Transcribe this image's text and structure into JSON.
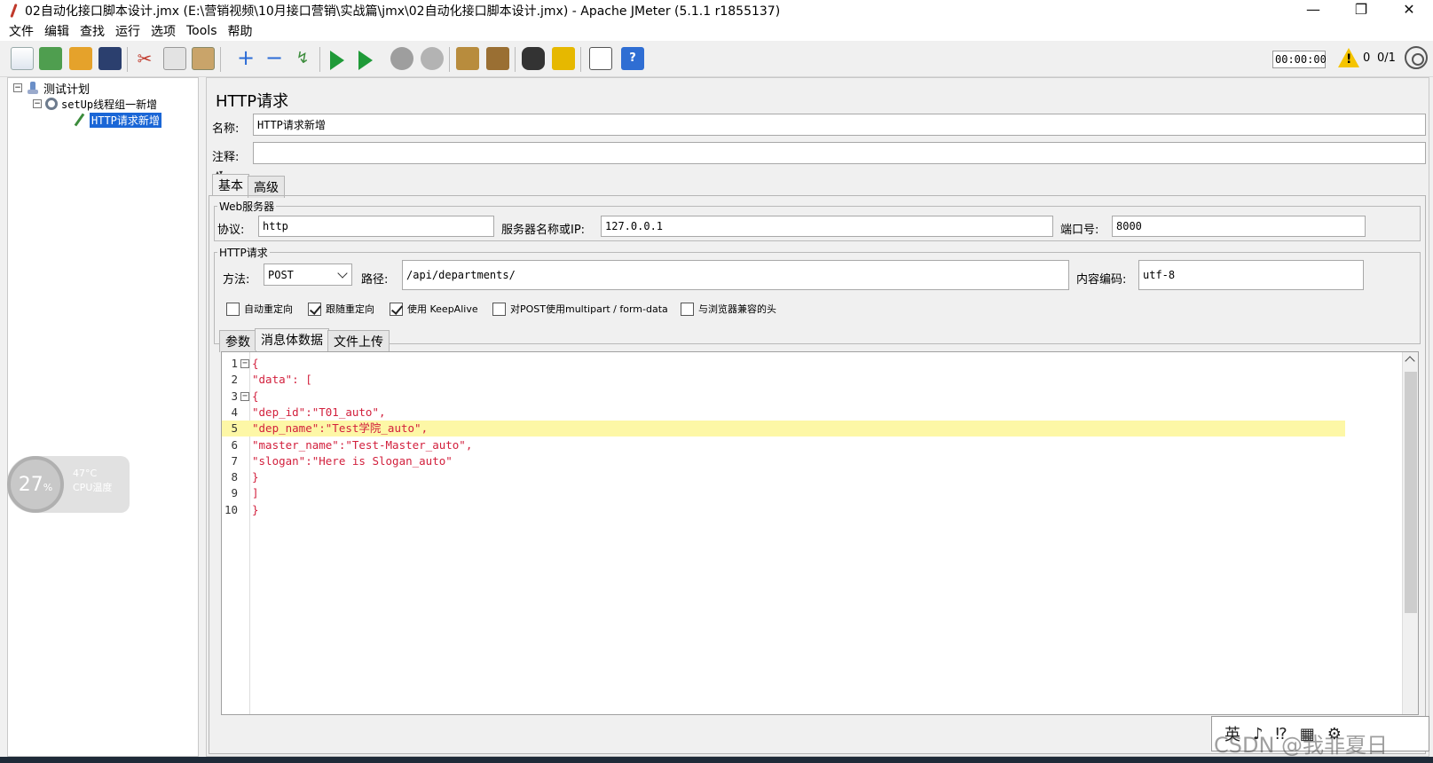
{
  "window": {
    "title": "02自动化接口脚本设计.jmx (E:\\营销视频\\10月接口营销\\实战篇\\jmx\\02自动化接口脚本设计.jmx) - Apache JMeter (5.1.1 r1855137)",
    "minimize": "—",
    "restore": "❐",
    "close": "✕"
  },
  "menu": [
    "文件",
    "编辑",
    "查找",
    "运行",
    "选项",
    "Tools",
    "帮助"
  ],
  "toolbar": {
    "timer": "00:00:00",
    "warning_count": "0",
    "threads": "0/1",
    "icons": [
      "new-icon",
      "templates-icon",
      "open-icon",
      "save-icon",
      "cut-icon",
      "copy-icon",
      "paste-icon",
      "expand-icon",
      "collapse-icon",
      "toggle-icon",
      "start-icon",
      "start-no-pause-icon",
      "stop-icon",
      "shutdown-icon",
      "clear-icon",
      "clear-all-icon",
      "search-icon",
      "reset-search-icon",
      "function-helper-icon",
      "help-icon"
    ]
  },
  "tree": {
    "test_plan": "测试计划",
    "thread_group": "setUp线程组一新增",
    "sampler": "HTTP请求新增"
  },
  "panel": {
    "title": "HTTP请求",
    "name_label": "名称:",
    "name_value": "HTTP请求新增",
    "comment_label": "注释:",
    "comment_value": "",
    "tabs": [
      "基本",
      "高级"
    ]
  },
  "web_server": {
    "group_title": "Web服务器",
    "protocol_label": "协议:",
    "protocol_value": "http",
    "server_label": "服务器名称或IP:",
    "server_value": "127.0.0.1",
    "port_label": "端口号:",
    "port_value": "8000"
  },
  "http_request": {
    "group_title": "HTTP请求",
    "method_label": "方法:",
    "method_value": "POST",
    "path_label": "路径:",
    "path_value": "/api/departments/",
    "encoding_label": "内容编码:",
    "encoding_value": "utf-8",
    "checkboxes": [
      {
        "label": "自动重定向",
        "checked": false
      },
      {
        "label": "跟随重定向",
        "checked": true
      },
      {
        "label": "使用 KeepAlive",
        "checked": true
      },
      {
        "label": "对POST使用multipart / form-data",
        "checked": false
      },
      {
        "label": "与浏览器兼容的头",
        "checked": false
      }
    ],
    "sub_tabs": [
      "参数",
      "消息体数据",
      "文件上传"
    ]
  },
  "body": {
    "lines": [
      {
        "n": "1",
        "fold": "⊟",
        "text": "{"
      },
      {
        "n": "2",
        "fold": "",
        "text": "\"data\": ["
      },
      {
        "n": "3",
        "fold": "⊟",
        "text": "{"
      },
      {
        "n": "4",
        "fold": "",
        "text": "\"dep_id\":\"T01_auto\","
      },
      {
        "n": "5",
        "fold": "",
        "text": "\"dep_name\":\"Test学院_auto\","
      },
      {
        "n": "6",
        "fold": "",
        "text": "\"master_name\":\"Test-Master_auto\","
      },
      {
        "n": "7",
        "fold": "",
        "text": "\"slogan\":\"Here is Slogan_auto\""
      },
      {
        "n": "8",
        "fold": "",
        "text": "}"
      },
      {
        "n": "9",
        "fold": "",
        "text": "]"
      },
      {
        "n": "10",
        "fold": "",
        "text": "}"
      }
    ],
    "highlighted_line": 5
  },
  "cpu_widget": {
    "percent": "27",
    "percent_unit": "%",
    "temp": "47°C",
    "label": "CPU温度"
  },
  "ime": {
    "items": [
      "英",
      "♪",
      "⁉",
      "▦",
      "⚙"
    ]
  },
  "watermark": "CSDN @我非夏日"
}
